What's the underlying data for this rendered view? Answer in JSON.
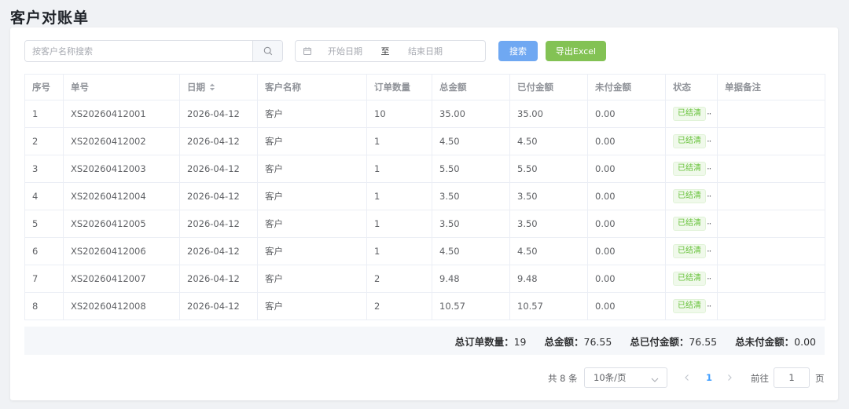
{
  "page": {
    "title": "客户对账单"
  },
  "toolbar": {
    "search_placeholder": "按客户名称搜索",
    "date_start_placeholder": "开始日期",
    "date_separator": "至",
    "date_end_placeholder": "结束日期",
    "search_button": "搜索",
    "export_button": "导出Excel",
    "search_color": "#6fa8f2",
    "export_color": "#83c254"
  },
  "table": {
    "columns": [
      "序号",
      "单号",
      "日期",
      "客户名称",
      "订单数量",
      "总金额",
      "已付金额",
      "未付金额",
      "状态",
      "单据备注"
    ],
    "rows": [
      [
        "1",
        "XS20260412001",
        "2026-04-12",
        "客户",
        "10",
        "35.00",
        "35.00",
        "0.00",
        "已结清",
        ""
      ],
      [
        "2",
        "XS20260412002",
        "2026-04-12",
        "客户",
        "1",
        "4.50",
        "4.50",
        "0.00",
        "已结清",
        ""
      ],
      [
        "3",
        "XS20260412003",
        "2026-04-12",
        "客户",
        "1",
        "5.50",
        "5.50",
        "0.00",
        "已结清",
        ""
      ],
      [
        "4",
        "XS20260412004",
        "2026-04-12",
        "客户",
        "1",
        "3.50",
        "3.50",
        "0.00",
        "已结清",
        ""
      ],
      [
        "5",
        "XS20260412005",
        "2026-04-12",
        "客户",
        "1",
        "3.50",
        "3.50",
        "0.00",
        "已结清",
        ""
      ],
      [
        "6",
        "XS20260412006",
        "2026-04-12",
        "客户",
        "1",
        "4.50",
        "4.50",
        "0.00",
        "已结清",
        ""
      ],
      [
        "7",
        "XS20260412007",
        "2026-04-12",
        "客户",
        "2",
        "9.48",
        "9.48",
        "0.00",
        "已结清",
        ""
      ],
      [
        "8",
        "XS20260412008",
        "2026-04-12",
        "客户",
        "2",
        "10.57",
        "10.57",
        "0.00",
        "已结清",
        ""
      ]
    ],
    "status_color": "#67c23a"
  },
  "summary": {
    "total_orders_label": "总订单数量：",
    "total_orders_value": "19",
    "total_amount_label": "总金额：",
    "total_amount_value": "76.55",
    "total_paid_label": "总已付金额：",
    "total_paid_value": "76.55",
    "total_unpaid_label": "总未付金额：",
    "total_unpaid_value": "0.00"
  },
  "pagination": {
    "total_text": "共 8 条",
    "page_size": "10条/页",
    "current_page": "1",
    "goto_label": "前往",
    "goto_value": "1",
    "page_unit": "页"
  }
}
